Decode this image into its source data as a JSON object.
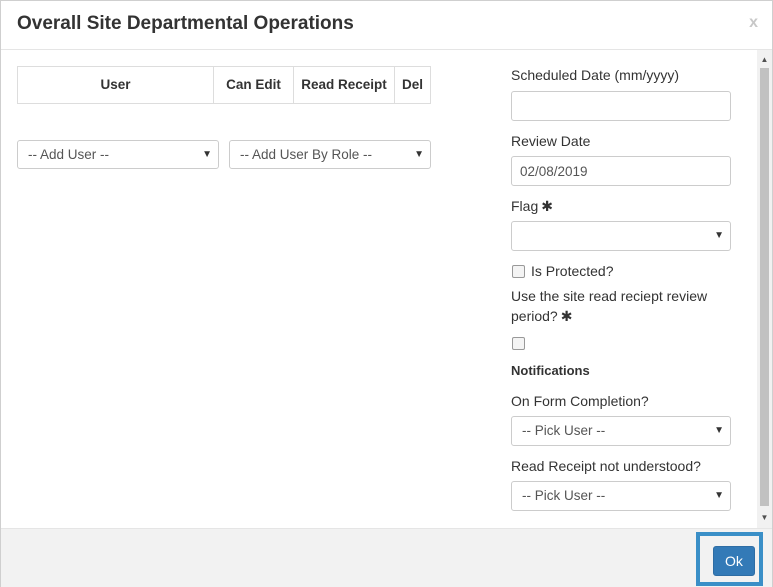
{
  "dialog": {
    "title": "Overall Site Departmental Operations",
    "close_label": "x"
  },
  "user_table": {
    "headers": [
      "User",
      "Can Edit",
      "Read Receipt",
      "Del"
    ]
  },
  "add_user_select": {
    "value": "-- Add User --"
  },
  "add_role_select": {
    "value": "-- Add User By Role --"
  },
  "form": {
    "scheduled_date": {
      "label": "Scheduled Date (mm/yyyy)",
      "value": ""
    },
    "review_date": {
      "label": "Review Date",
      "value": "02/08/2019"
    },
    "flag": {
      "label": "Flag",
      "required_mark": "✱",
      "value": ""
    },
    "is_protected": {
      "label": "Is Protected?",
      "checked": false
    },
    "read_receipt_period": {
      "label": "Use the site read reciept review period?",
      "required_mark": "✱",
      "checked": false
    },
    "notifications_heading": "Notifications",
    "on_form_completion": {
      "label": "On Form Completion?",
      "value": "-- Pick User --"
    },
    "read_receipt_not_understood": {
      "label": "Read Receipt not understood?",
      "value": "-- Pick User --"
    }
  },
  "footer": {
    "ok_label": "Ok"
  },
  "icons": {
    "caret": "caret-down-icon",
    "scroll_up": "scroll-up-arrow",
    "scroll_down": "scroll-down-arrow"
  },
  "colors": {
    "primary": "#337ab7",
    "highlight": "#3a8fc7"
  }
}
